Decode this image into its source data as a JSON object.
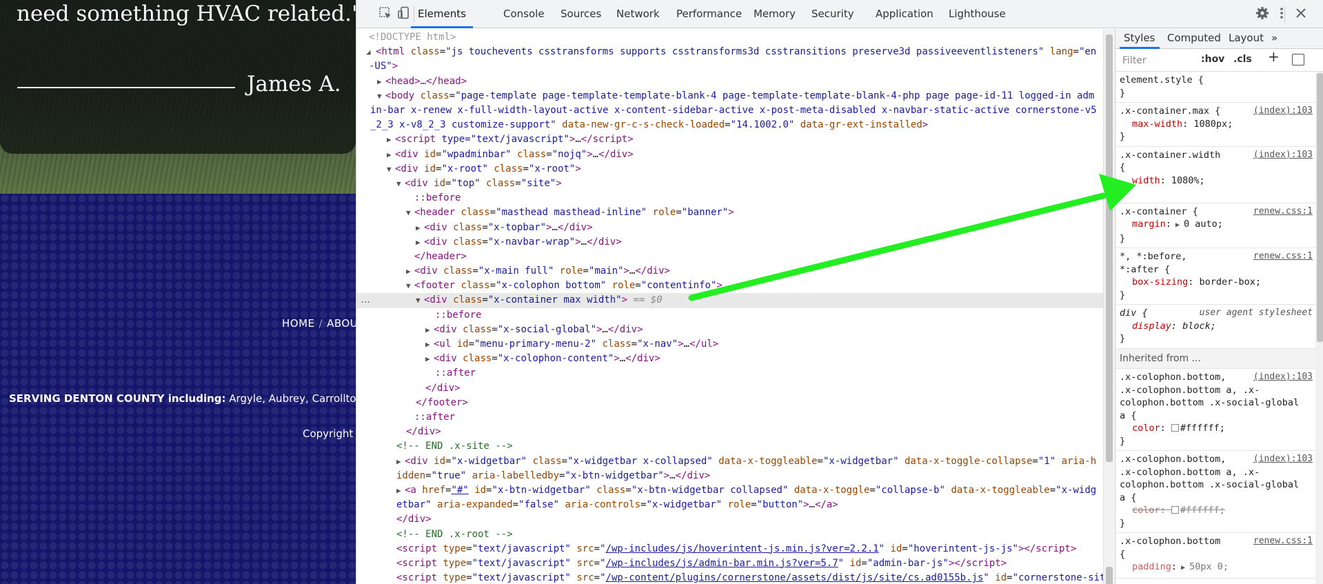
{
  "website": {
    "quote_tail": "need something HVAC related.\"",
    "author": "James A.",
    "nav": [
      "HOME",
      "ABOU"
    ],
    "nav_separator": "/",
    "serving_bold": "SERVING DENTON COUNTY including:",
    "serving_rest": " Argyle, Aubrey, Carrollton,",
    "copyright": "Copyright"
  },
  "devtools": {
    "tabs": [
      "Elements",
      "Console",
      "Sources",
      "Network",
      "Performance",
      "Memory",
      "Security",
      "Application",
      "Lighthouse"
    ],
    "active_tab": "Elements",
    "inspect_icon": "inspect-element-icon",
    "device_icon": "device-toolbar-icon",
    "settings_icon": "gear-icon",
    "more_icon": "kebab-menu-icon",
    "close_icon": "close-icon",
    "sidebar_tabs": [
      "Styles",
      "Computed",
      "Layout",
      "»"
    ],
    "filter_placeholder": "Filter",
    "hov": ":hov",
    "cls": ".cls",
    "plus": "+",
    "inherited_from": "Inherited from ...",
    "selected_suffix": "== $0",
    "ellipsis": "…",
    "elements_lines": {
      "doctype": "<!DOCTYPE html>",
      "html_open_a": "<html",
      "html_class_attr": "class",
      "html_class_val": "\"js touchevents csstransforms supports csstransforms3d csstransitions preserve3d passiveeventlisteners\"",
      "html_lang_attr": "lang",
      "html_lang_val": "\"en-US\"",
      "head": "<head>…</head>",
      "body_tag": "<body",
      "body_class_val": "\"page-template page-template-template-blank-4 page-template-template-blank-4-php page page-id-11 logged-in admin-bar x-renew x-full-width-layout-active x-content-sidebar-active x-post-meta-disabled x-navbar-static-active cornerstone-v5_2_3 x-v8_2_3 customize-support\"",
      "body_attr2": "data-new-gr-c-s-check-loaded",
      "body_val2": "\"14.1002.0\"",
      "body_attr3": "data-gr-ext-installed",
      "script1": "type=\"text/javascript\"",
      "wpadminbar_id": "\"wpadminbar\"",
      "wpadminbar_class": "\"nojq\"",
      "xroot_id": "\"x-root\"",
      "xroot_class": "\"x-root\"",
      "top_id": "\"top\"",
      "top_class": "\"site\"",
      "before": "::before",
      "after": "::after",
      "header_class": "\"masthead masthead-inline\"",
      "header_role": "\"banner\"",
      "topbar_class": "\"x-topbar\"",
      "navbar_class": "\"x-navbar-wrap\"",
      "header_close": "</header>",
      "main_class": "\"x-main full\"",
      "main_role": "\"main\"",
      "footer_class": "\"x-colophon bottom\"",
      "footer_role": "\"contentinfo\"",
      "container_class": "\"x-container max width\"",
      "social_class": "\"x-social-global\"",
      "menu_id": "\"menu-primary-menu-2\"",
      "menu_class": "\"x-nav\"",
      "colophon_content_class": "\"x-colophon-content\"",
      "div_close": "</div>",
      "footer_close": "</footer>",
      "end_site": "<!-- END .x-site -->",
      "widgetbar_id": "\"x-widgetbar\"",
      "widgetbar_class": "\"x-widgetbar x-collapsed\"",
      "widgetbar_toggleable": "\"x-widgetbar\"",
      "widgetbar_collapse": "\"1\"",
      "widgetbar_hidden": "\"true\"",
      "widgetbar_labelledby": "\"x-btn-widgetbar\"",
      "a_href": "\"#\"",
      "a_id": "\"x-btn-widgetbar\"",
      "a_class": "\"x-btn-widgetbar collapsed\"",
      "a_toggle": "\"collapse-b\"",
      "a_toggleable": "\"x-widgetbar\"",
      "a_expanded": "\"false\"",
      "a_controls": "\"x-widgetbar\"",
      "a_role": "\"button\"",
      "end_root": "<!-- END .x-root -->",
      "src1": "/wp-includes/js/hoverintent-js.min.js?ver=2.2.1",
      "id1": "\"hoverintent-js-js\"",
      "src2": "/wp-includes/js/admin-bar.min.js?ver=5.7",
      "id2": "\"admin-bar-js\"",
      "src3": "/wp-content/plugins/cornerstone/assets/dist/js/site/cs.ad0155b.js",
      "id3": "\"cornerstone-sit"
    },
    "styles": [
      {
        "selector": "element.style {",
        "source": "",
        "props": []
      },
      {
        "selector": ".x-container.max {",
        "source": "(index):103",
        "props": [
          {
            "name": "max-width",
            "value": "1080px;"
          }
        ]
      },
      {
        "selector": ".x-container.width",
        "selector2": "{",
        "source": "(index):103",
        "props": [
          {
            "name": "width",
            "value": "1080%;"
          }
        ]
      },
      {
        "selector": ".x-container {",
        "source": "renew.css:1",
        "props": [
          {
            "name": "margin",
            "value": "0 auto;"
          }
        ]
      },
      {
        "selector": "*, *:before,",
        "selector2": "*:after {",
        "source": "renew.css:1",
        "props": [
          {
            "name": "box-sizing",
            "value": "border-box;"
          }
        ]
      },
      {
        "selector": "div {",
        "source": "user agent stylesheet",
        "props": [
          {
            "name": "display",
            "value": "block;"
          }
        ]
      }
    ],
    "inherited_rules": [
      {
        "selector_lines": [
          ".x-colophon.bottom,",
          ".x-colophon.bottom a, .x-",
          "colophon.bottom .x-social-global",
          "a {"
        ],
        "source": "(index):103",
        "prop": "color",
        "value": "#ffffff;",
        "struck": false
      },
      {
        "selector_lines": [
          ".x-colophon.bottom,",
          ".x-colophon.bottom a, .x-",
          "colophon.bottom .x-social-global",
          "a {"
        ],
        "source": "(index):103",
        "prop": "color",
        "value": "#ffffff;",
        "struck": true
      },
      {
        "selector_lines": [
          ".x-colophon.bottom",
          "{"
        ],
        "source": "renew.css:1",
        "prop": "padding",
        "value": "50px 0;",
        "struck": false
      }
    ],
    "annotation_color": "#22ee22",
    "accent_color": "#1a73e8"
  }
}
